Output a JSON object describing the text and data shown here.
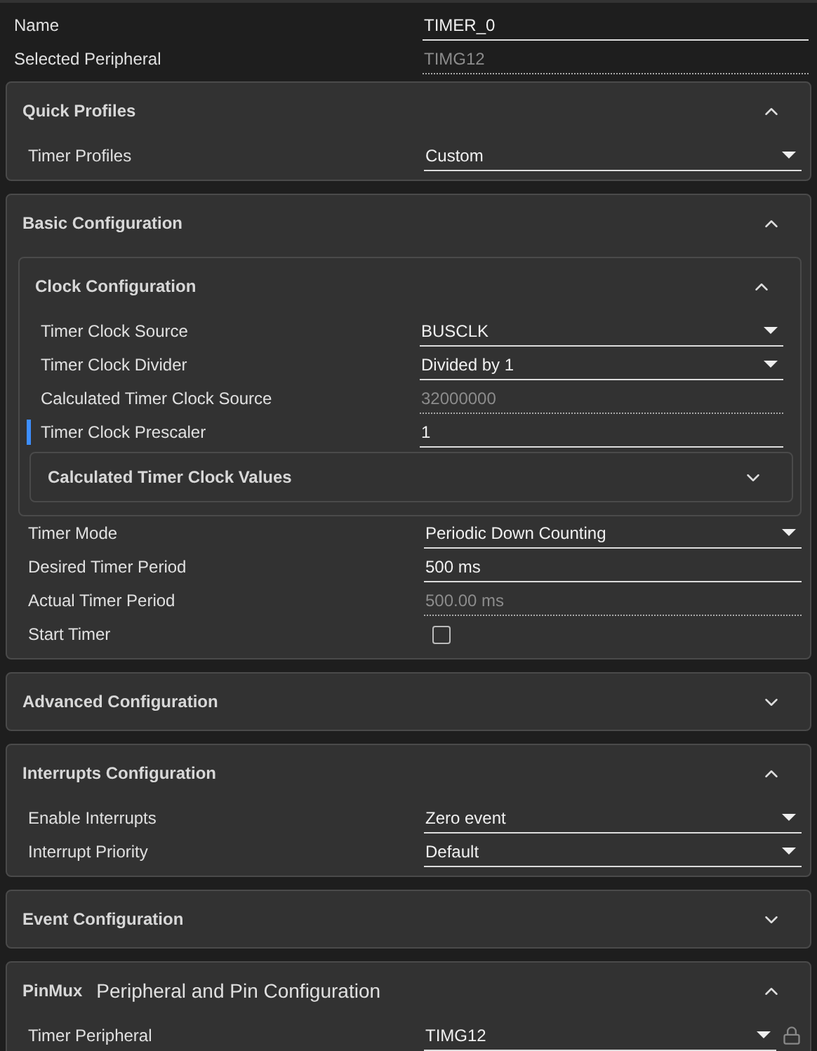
{
  "fields": [
    {
      "kind": "input",
      "label": "Name",
      "value": "TIMER_0"
    },
    {
      "kind": "readonly",
      "label": "Selected Peripheral",
      "value": "TIMG12"
    }
  ],
  "sections": [
    {
      "kind": "panel",
      "title": "Quick Profiles",
      "expanded": true,
      "rows": [
        {
          "kind": "select",
          "label": "Timer Profiles",
          "value": "Custom"
        }
      ]
    },
    {
      "kind": "panel",
      "title": "Basic Configuration",
      "expanded": true,
      "rows": [
        {
          "kind": "panel",
          "title": "Clock Configuration",
          "expanded": true,
          "rows": [
            {
              "kind": "select",
              "label": "Timer Clock Source",
              "value": "BUSCLK",
              "highlighted": false
            },
            {
              "kind": "select",
              "label": "Timer Clock Divider",
              "value": "Divided by 1",
              "highlighted": false
            },
            {
              "kind": "readonly",
              "label": "Calculated Timer Clock Source",
              "value": "32000000",
              "highlighted": false
            },
            {
              "kind": "input",
              "label": "Timer Clock Prescaler",
              "value": "1",
              "highlighted": true
            },
            {
              "kind": "panel",
              "title": "Calculated Timer Clock Values",
              "expanded": false
            }
          ]
        },
        {
          "kind": "select",
          "label": "Timer Mode",
          "value": "Periodic Down Counting"
        },
        {
          "kind": "input",
          "label": "Desired Timer Period",
          "value": "500 ms"
        },
        {
          "kind": "readonly",
          "label": "Actual Timer Period",
          "value": "500.00 ms"
        },
        {
          "kind": "checkbox",
          "label": "Start Timer",
          "checked": false
        }
      ]
    },
    {
      "kind": "panel",
      "title": "Advanced Configuration",
      "expanded": false
    },
    {
      "kind": "panel",
      "title": "Interrupts Configuration",
      "expanded": true,
      "rows": [
        {
          "kind": "select",
          "label": "Enable Interrupts",
          "value": "Zero event"
        },
        {
          "kind": "select",
          "label": "Interrupt Priority",
          "value": "Default"
        }
      ]
    },
    {
      "kind": "panel",
      "title": "Event Configuration",
      "expanded": false
    },
    {
      "kind": "panel",
      "title": "PinMux",
      "subtitle": "Peripheral and Pin Configuration",
      "expanded": true,
      "rows": [
        {
          "kind": "select",
          "label": "Timer Peripheral",
          "value": "TIMG12",
          "locked": true
        }
      ]
    }
  ]
}
